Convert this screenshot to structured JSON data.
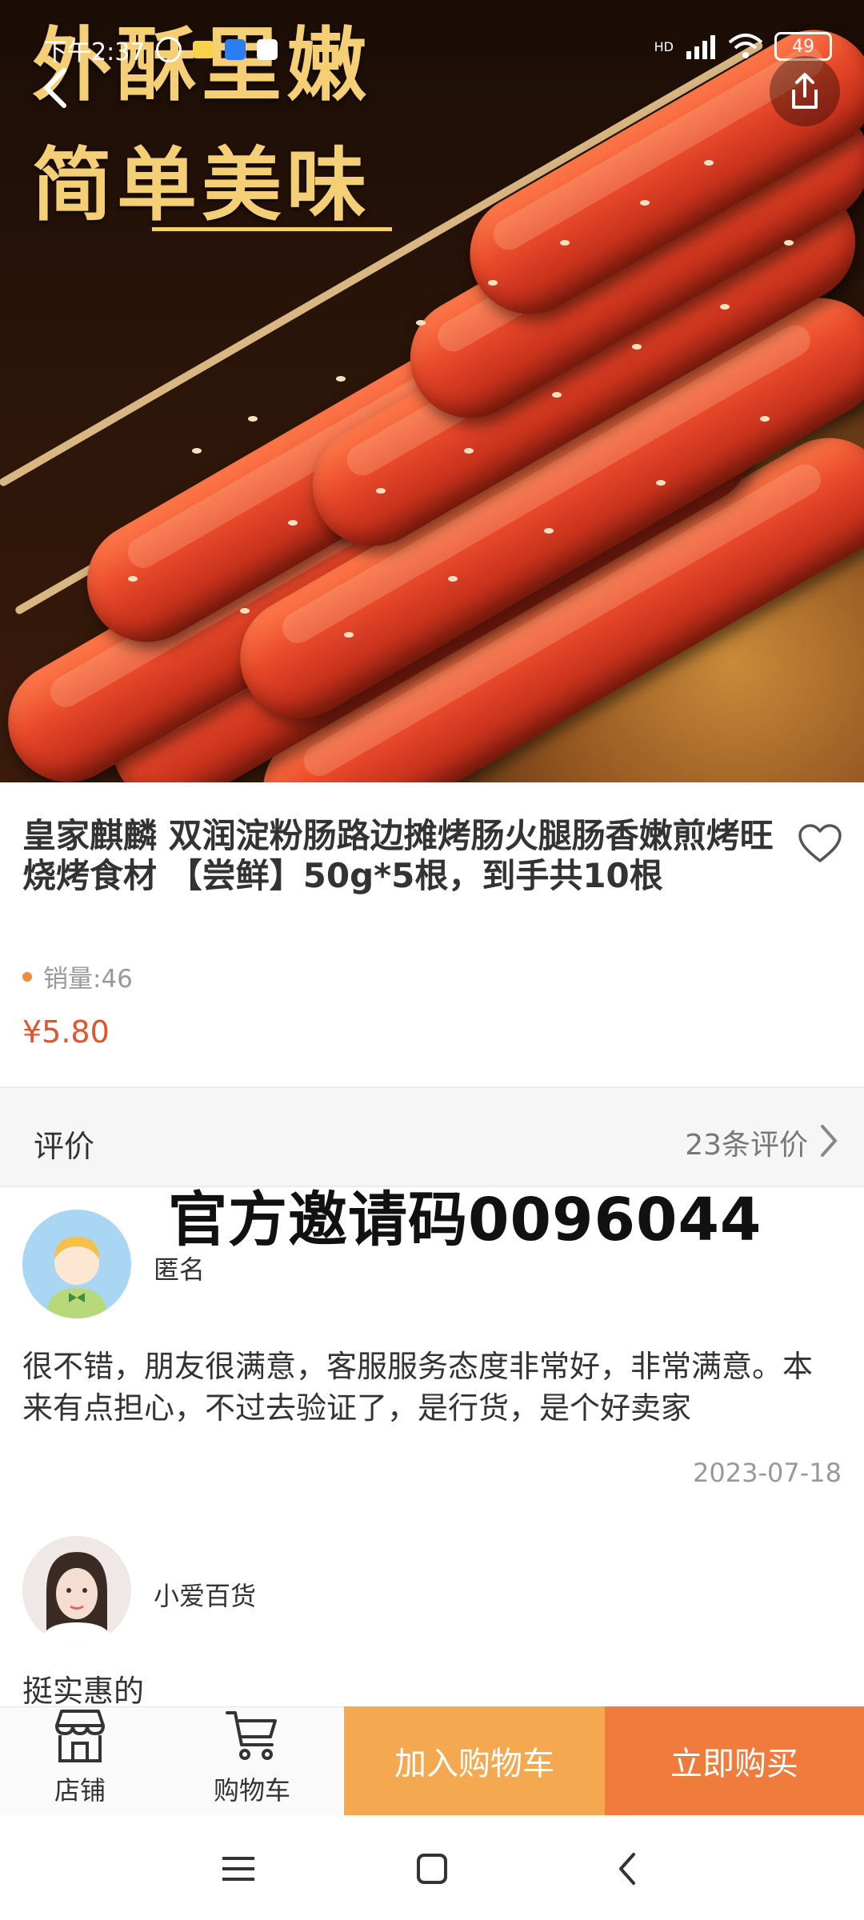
{
  "status_bar": {
    "time": "下午2:37",
    "network": "HD",
    "battery": "49"
  },
  "hero": {
    "line1": "外酥里嫩",
    "line2": "简单美味"
  },
  "product": {
    "title": "皇家麒麟 双润淀粉肠路边摊烤肠火腿肠香嫩煎烤旺烧烤食材 【尝鲜】50g*5根，到手共10根",
    "sales": "销量:46",
    "price": "¥5.80"
  },
  "reviews_section": {
    "label": "评价",
    "count": "23条评价"
  },
  "watermark": "官方邀请码0096044",
  "reviews": [
    {
      "name": "匿名",
      "text": "很不错，朋友很满意，客服服务态度非常好，非常满意。本来有点担心，不过去验证了，是行货，是个好卖家",
      "date": "2023-07-18"
    },
    {
      "name": "小爱百货",
      "text": "挺实惠的"
    }
  ],
  "bottom_bar": {
    "shop": "店铺",
    "cart": "购物车",
    "add_to_cart": "加入购物车",
    "buy_now": "立即购买"
  },
  "colors": {
    "price": "#e3532d",
    "add_to_cart": "#f4a850",
    "buy_now": "#ef7c3d",
    "hero_text": "#f4cf76"
  },
  "icons": [
    "back-icon",
    "share-icon",
    "heart-icon",
    "chevron-right-icon",
    "store-icon",
    "cart-icon",
    "menu-icon",
    "home-icon",
    "nav-back-icon"
  ]
}
